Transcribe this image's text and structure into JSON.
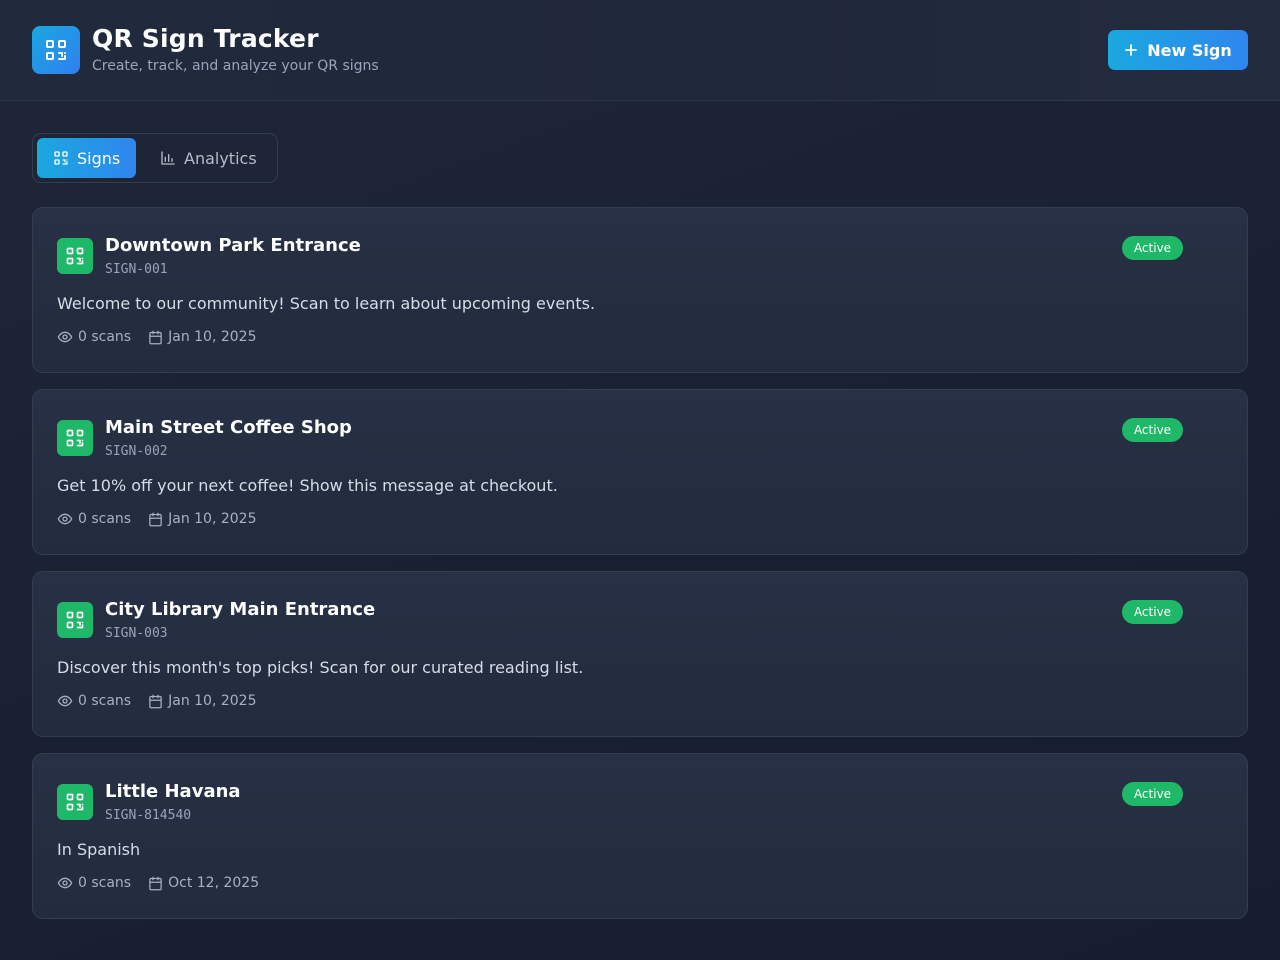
{
  "header": {
    "title": "QR Sign Tracker",
    "subtitle": "Create, track, and analyze your QR signs",
    "logo_icon": "qr-code-icon",
    "new_button": {
      "icon": "plus-icon",
      "label": "New Sign"
    }
  },
  "tabs": [
    {
      "label": "Signs",
      "icon": "qr-code-icon",
      "active": true
    },
    {
      "label": "Analytics",
      "icon": "bar-chart-icon",
      "active": false
    }
  ],
  "signs": [
    {
      "title": "Downtown Park Entrance",
      "id": "SIGN-001",
      "status": "Active",
      "message": "Welcome to our community! Scan to learn about upcoming events.",
      "scans": "0 scans",
      "date": "Jan 10, 2025"
    },
    {
      "title": "Main Street Coffee Shop",
      "id": "SIGN-002",
      "status": "Active",
      "message": "Get 10% off your next coffee! Show this message at checkout.",
      "scans": "0 scans",
      "date": "Jan 10, 2025"
    },
    {
      "title": "City Library Main Entrance",
      "id": "SIGN-003",
      "status": "Active",
      "message": "Discover this month's top picks! Scan for our curated reading list.",
      "scans": "0 scans",
      "date": "Jan 10, 2025"
    },
    {
      "title": "Little Havana",
      "id": "SIGN-814540",
      "status": "Active",
      "message": "In Spanish",
      "scans": "0 scans",
      "date": "Oct 12, 2025"
    }
  ],
  "colors": {
    "accent": "#1aa8e0",
    "accent_end": "#2f86ee",
    "success": "#1fb868",
    "background": "#192133",
    "card": "#273044"
  }
}
